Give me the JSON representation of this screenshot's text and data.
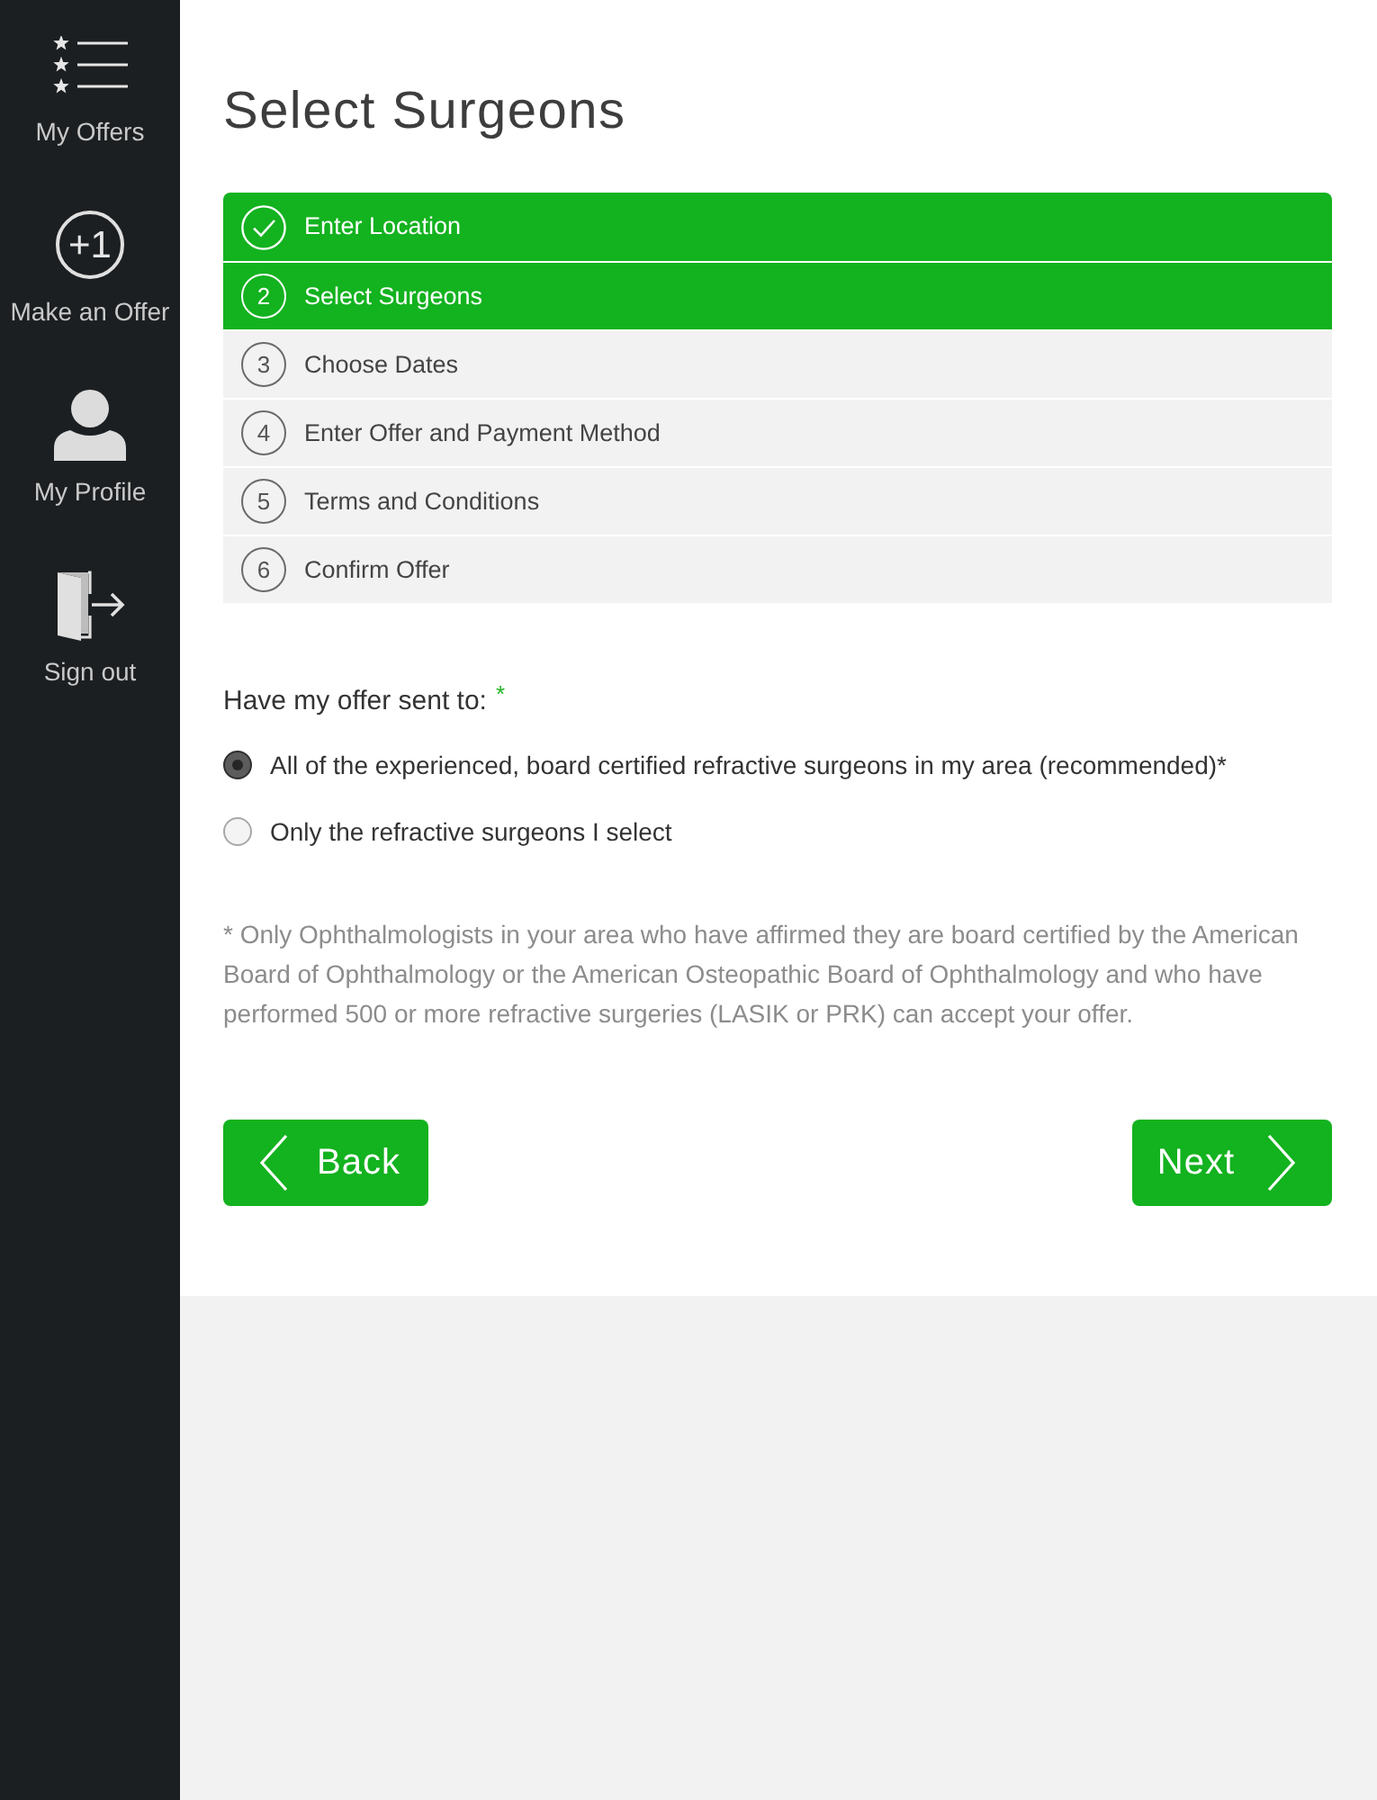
{
  "sidebar": {
    "items": [
      {
        "kind": "offers",
        "label": "My Offers"
      },
      {
        "kind": "add",
        "icon_text": "+1",
        "label": "Make an Offer"
      },
      {
        "kind": "profile",
        "label": "My Profile"
      },
      {
        "kind": "signout",
        "label": "Sign out"
      }
    ]
  },
  "title": "Select Surgeons",
  "steps": [
    {
      "completed": true,
      "active": true,
      "label": "Enter Location"
    },
    {
      "completed": false,
      "active": true,
      "number": "2",
      "label": "Select Surgeons"
    },
    {
      "completed": false,
      "active": false,
      "number": "3",
      "label": "Choose Dates"
    },
    {
      "completed": false,
      "active": false,
      "number": "4",
      "label": "Enter Offer and Payment Method"
    },
    {
      "completed": false,
      "active": false,
      "number": "5",
      "label": "Terms and Conditions"
    },
    {
      "completed": false,
      "active": false,
      "number": "6",
      "label": "Confirm Offer"
    }
  ],
  "recipient": {
    "label": "Have my offer sent to:",
    "required_mark": "*",
    "options": [
      {
        "label": "All of the experienced, board certified refractive surgeons in my area (recommended)*",
        "selected": true
      },
      {
        "label": "Only the refractive surgeons I select",
        "selected": false
      }
    ]
  },
  "footnote": "* Only Ophthalmologists in your area who have affirmed they are board certified by the American Board of Ophthalmology or the American Osteopathic Board of Ophthalmology and who have performed 500 or more refractive surgeries (LASIK or PRK) can accept your offer.",
  "buttons": [
    {
      "kind": "back",
      "label": "Back"
    },
    {
      "kind": "next",
      "label": "Next"
    }
  ]
}
